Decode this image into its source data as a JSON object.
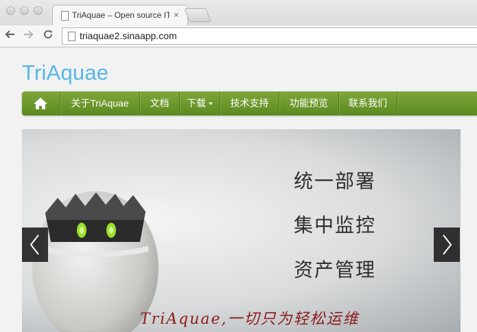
{
  "browser": {
    "tab_title": "TriAquae – Open source IT",
    "tab_close": "×",
    "url": "triaquae2.sinaapp.com"
  },
  "site": {
    "title": "TriAquae"
  },
  "nav": {
    "items": [
      {
        "label": "关于TriAquae"
      },
      {
        "label": "文档"
      },
      {
        "label": "下载"
      },
      {
        "label": "技术支持"
      },
      {
        "label": "功能预览"
      },
      {
        "label": "联系我们"
      }
    ]
  },
  "carousel": {
    "lines": [
      "统一部署",
      "集中监控",
      "资产管理"
    ],
    "slogan": "TriAquae,一切只为轻松运维"
  },
  "colors": {
    "title": "#55b6e6",
    "nav_green": "#6b9a2a",
    "slogan": "#8b1a1a"
  },
  "icons": {
    "home": "home-icon",
    "prev": "chevron-left-icon",
    "next": "chevron-right-icon"
  }
}
